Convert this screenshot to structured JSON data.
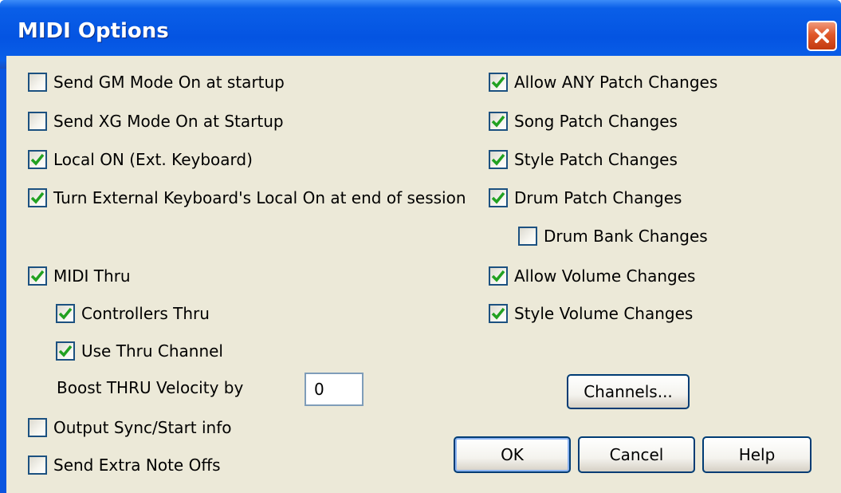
{
  "window": {
    "title": "MIDI Options"
  },
  "left_options": [
    {
      "label": "Send GM Mode On at startup",
      "checked": false
    },
    {
      "label": "Send XG Mode On at Startup",
      "checked": false
    },
    {
      "label": "Local ON (Ext. Keyboard)",
      "checked": true
    },
    {
      "label": "Turn External Keyboard's Local On at end of session",
      "checked": true
    },
    {
      "label": "MIDI Thru",
      "checked": true
    },
    {
      "label": "Controllers Thru",
      "checked": true
    },
    {
      "label": "Use Thru Channel",
      "checked": true
    },
    {
      "label": "Output Sync/Start info",
      "checked": false
    },
    {
      "label": "Send Extra Note Offs",
      "checked": false
    }
  ],
  "boost": {
    "label": "Boost THRU Velocity by",
    "value": "0"
  },
  "right_options": [
    {
      "label": "Allow ANY Patch Changes",
      "checked": true
    },
    {
      "label": "Song Patch Changes",
      "checked": true
    },
    {
      "label": "Style Patch Changes",
      "checked": true
    },
    {
      "label": "Drum Patch Changes",
      "checked": true
    },
    {
      "label": "Drum Bank Changes",
      "checked": false
    },
    {
      "label": "Allow Volume Changes",
      "checked": true
    },
    {
      "label": "Style Volume Changes",
      "checked": true
    }
  ],
  "buttons": {
    "channels": "Channels...",
    "ok": "OK",
    "cancel": "Cancel",
    "help": "Help"
  },
  "colors": {
    "titlebar": "#0454e2",
    "dialog_bg": "#ece9d8",
    "check_mark": "#21a121",
    "close_button": "#e0582a"
  }
}
